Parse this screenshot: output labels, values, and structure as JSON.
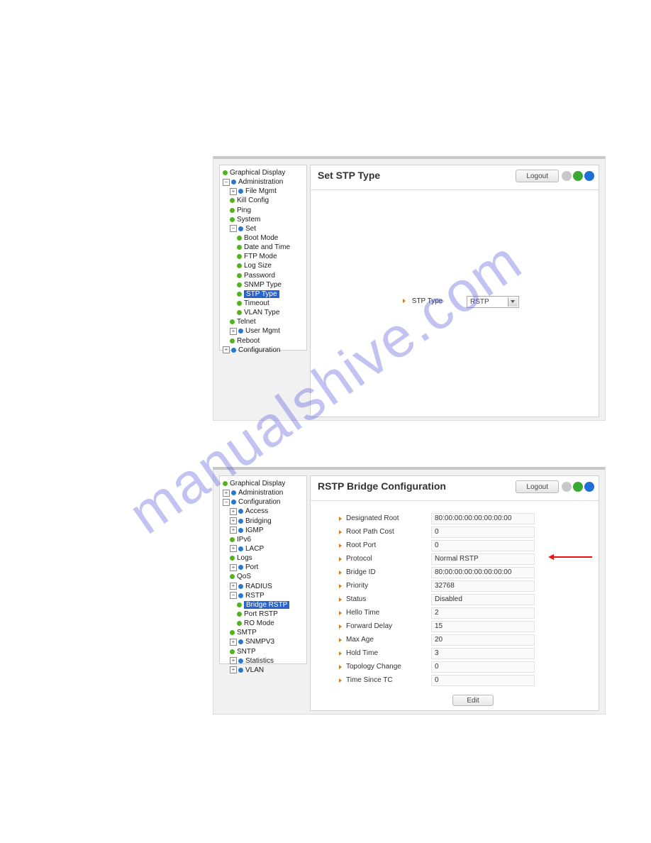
{
  "watermark": "manualshive.com",
  "panel1": {
    "title": "Set STP Type",
    "logout": "Logout",
    "tree": {
      "graphical": "Graphical Display",
      "admin": "Administration",
      "filemgmt": "File Mgmt",
      "items1": [
        "Kill Config",
        "Ping",
        "System"
      ],
      "set": "Set",
      "setitems": [
        "Boot Mode",
        "Date and Time",
        "FTP Mode",
        "Log Size",
        "Password",
        "SNMP Type",
        "STP Type",
        "Timeout",
        "VLAN Type"
      ],
      "telnet": "Telnet",
      "usermgmt": "User Mgmt",
      "reboot": "Reboot",
      "config": "Configuration"
    },
    "form": {
      "label": "STP Type",
      "value": "RSTP"
    }
  },
  "panel2": {
    "title": "RSTP Bridge Configuration",
    "logout": "Logout",
    "tree": {
      "graphical": "Graphical Display",
      "admin": "Administration",
      "config": "Configuration",
      "access": "Access",
      "bridging": "Bridging",
      "igmp": "IGMP",
      "ipv6": "IPv6",
      "lacp": "LACP",
      "logs": "Logs",
      "port": "Port",
      "qos": "QoS",
      "radius": "RADIUS",
      "rstp": "RSTP",
      "bridgerstp": "Bridge RSTP",
      "portrstp": "Port RSTP",
      "romode": "RO Mode",
      "smtp": "SMTP",
      "snmpv3": "SNMPV3",
      "sntp": "SNTP",
      "stats": "Statistics",
      "vlan": "VLAN"
    },
    "rows": [
      {
        "label": "Designated Root",
        "value": "80:00:00:00:00:00:00:00"
      },
      {
        "label": "Root Path Cost",
        "value": "0"
      },
      {
        "label": "Root Port",
        "value": "0"
      },
      {
        "label": "Protocol",
        "value": "Normal RSTP"
      },
      {
        "label": "Bridge ID",
        "value": "80:00:00:00:00:00:00:00"
      },
      {
        "label": "Priority",
        "value": "32768"
      },
      {
        "label": "Status",
        "value": "Disabled"
      },
      {
        "label": "Hello Time",
        "value": "2"
      },
      {
        "label": "Forward Delay",
        "value": "15"
      },
      {
        "label": "Max Age",
        "value": "20"
      },
      {
        "label": "Hold Time",
        "value": "3"
      },
      {
        "label": "Topology Change",
        "value": "0"
      },
      {
        "label": "Time Since TC",
        "value": "0"
      }
    ],
    "edit": "Edit"
  }
}
